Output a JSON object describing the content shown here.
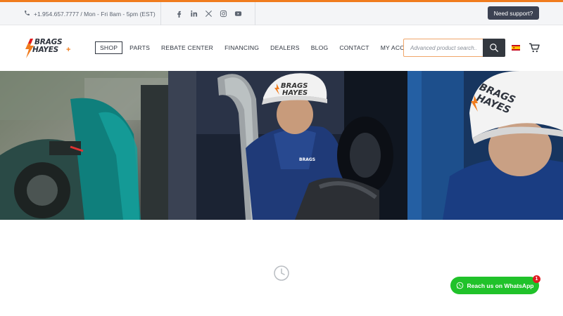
{
  "topbar": {
    "contact_text": "+1.954.657.7777 / Mon - Fri 8am - 5pm (EST)",
    "support_label": "Need support?",
    "socials": [
      "facebook-icon",
      "linkedin-icon",
      "x-icon",
      "instagram-icon",
      "youtube-icon"
    ]
  },
  "brand": {
    "line1": "BRAGS",
    "line2": "HAYES",
    "plus": "+",
    "accent": "#f07c1e"
  },
  "nav": {
    "items": [
      {
        "label": "SHOP",
        "active": true
      },
      {
        "label": "PARTS"
      },
      {
        "label": "REBATE CENTER"
      },
      {
        "label": "FINANCING"
      },
      {
        "label": "DEALERS"
      },
      {
        "label": "BLOG"
      },
      {
        "label": "CONTACT"
      },
      {
        "label": "MY ACCOUNT"
      }
    ]
  },
  "search": {
    "placeholder": "Advanced product search..."
  },
  "hero": {
    "helmet_text_1": "BRAGS",
    "helmet_text_2": "HAYES"
  },
  "whatsapp": {
    "label": "Reach us on WhatsApp",
    "badge": "1",
    "color": "#20c22a"
  }
}
